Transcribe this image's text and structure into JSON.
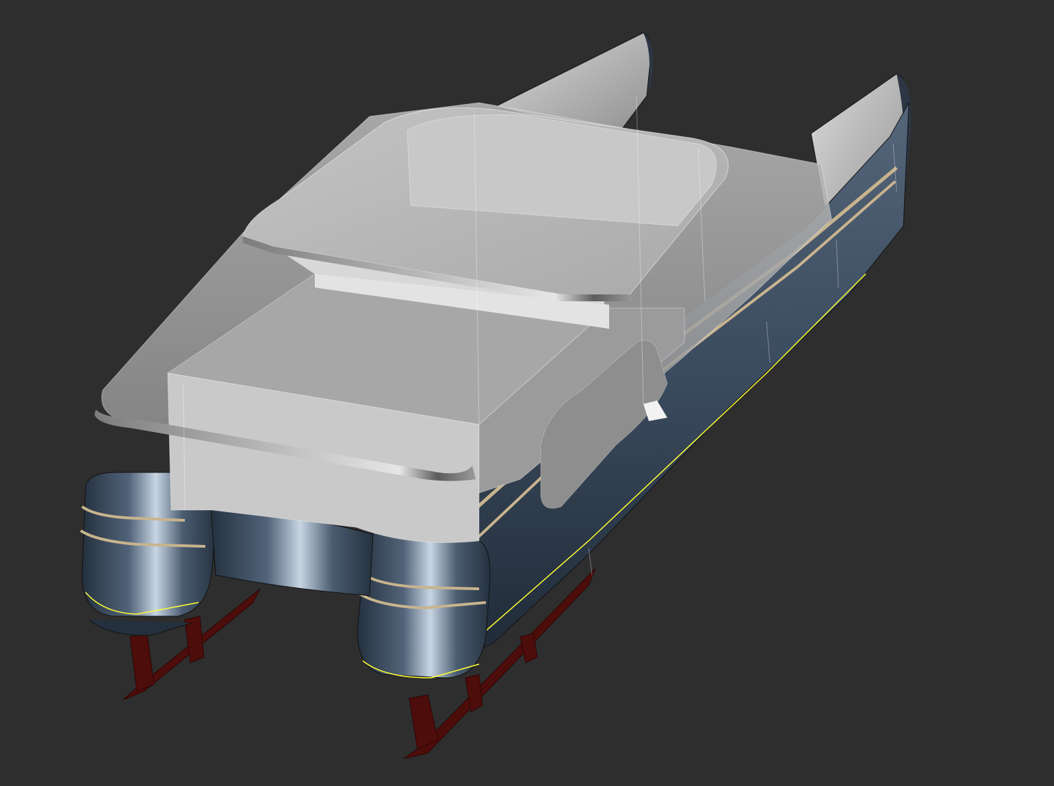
{
  "viewport": {
    "background": "#2e2e2e",
    "model": "catamaran-3d-render"
  },
  "colors": {
    "hull_dark": "#1f2a38",
    "hull_mid": "#3e4e62",
    "hull_light": "#c9d6e4",
    "superstructure": "#b8b8b8",
    "roof": "#cfcfcf",
    "rub_rail": "#c8b48e",
    "waterline": "#ffff33",
    "keel_frame": "#5a0f0d"
  }
}
